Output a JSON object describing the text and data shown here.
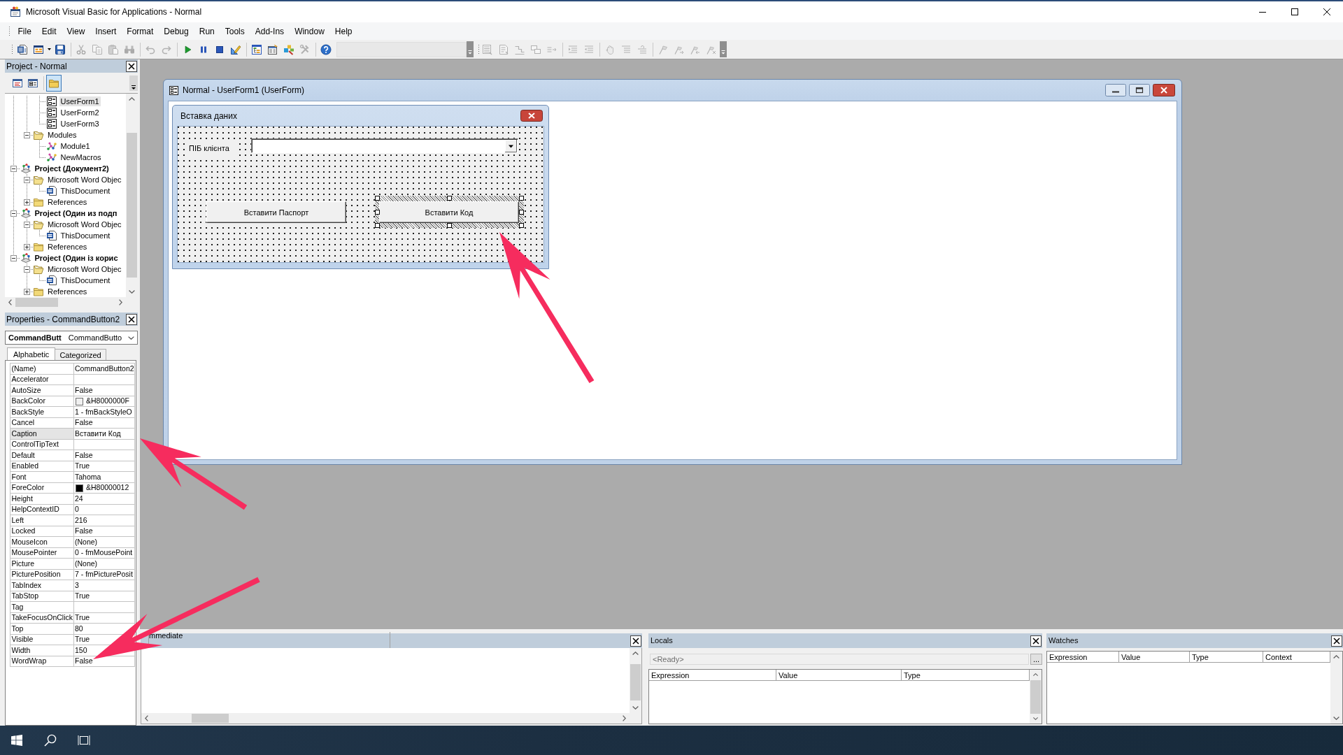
{
  "window": {
    "title": "Microsoft Visual Basic for Applications - Normal"
  },
  "menu": [
    "File",
    "Edit",
    "View",
    "Insert",
    "Format",
    "Debug",
    "Run",
    "Tools",
    "Add-Ins",
    "Window",
    "Help"
  ],
  "standard_toolbar": [
    {
      "kind": "word",
      "disabled": false
    },
    {
      "kind": "insert-form",
      "disabled": false
    },
    {
      "kind": "save",
      "disabled": false
    },
    {
      "kind": "separator"
    },
    {
      "kind": "cut",
      "disabled": true
    },
    {
      "kind": "copy",
      "disabled": true
    },
    {
      "kind": "paste",
      "disabled": true
    },
    {
      "kind": "find",
      "disabled": true
    },
    {
      "kind": "separator"
    },
    {
      "kind": "undo",
      "disabled": true
    },
    {
      "kind": "redo",
      "disabled": true
    },
    {
      "kind": "separator"
    },
    {
      "kind": "run",
      "disabled": false
    },
    {
      "kind": "break",
      "disabled": false
    },
    {
      "kind": "reset",
      "disabled": false
    },
    {
      "kind": "design-mode",
      "disabled": false
    },
    {
      "kind": "separator"
    },
    {
      "kind": "project-explorer",
      "disabled": false
    },
    {
      "kind": "properties-window",
      "disabled": false
    },
    {
      "kind": "object-browser",
      "disabled": false
    },
    {
      "kind": "toolbox",
      "disabled": true
    },
    {
      "kind": "separator"
    },
    {
      "kind": "help",
      "disabled": false
    }
  ],
  "edit_toolbar": [
    {
      "kind": "list-properties",
      "disabled": true
    },
    {
      "kind": "list-constants",
      "disabled": true
    },
    {
      "kind": "quick-info",
      "disabled": true
    },
    {
      "kind": "parameter-info",
      "disabled": true
    },
    {
      "kind": "complete-word",
      "disabled": true
    },
    {
      "kind": "separator"
    },
    {
      "kind": "indent",
      "disabled": true
    },
    {
      "kind": "outdent",
      "disabled": true
    },
    {
      "kind": "separator"
    },
    {
      "kind": "toggle-breakpoint",
      "disabled": true
    },
    {
      "kind": "comment-block",
      "disabled": true
    },
    {
      "kind": "uncomment-block",
      "disabled": true
    },
    {
      "kind": "separator"
    },
    {
      "kind": "toggle-bookmark",
      "disabled": true
    },
    {
      "kind": "next-bookmark",
      "disabled": true
    },
    {
      "kind": "previous-bookmark",
      "disabled": true
    },
    {
      "kind": "clear-bookmarks",
      "disabled": true
    }
  ],
  "project": {
    "title": "Project - Normal",
    "toolbar": [
      {
        "kind": "view-code",
        "pressed": false
      },
      {
        "kind": "view-object",
        "pressed": false
      },
      {
        "kind": "toggle-folders",
        "pressed": true
      }
    ],
    "tree": [
      {
        "children": [
          {
            "children": [
              {
                "label": "UserForm1",
                "kind": "form",
                "selected": true
              },
              {
                "label": "UserForm2",
                "kind": "form",
                "selected": false
              },
              {
                "label": "UserForm3",
                "kind": "form",
                "selected": false
              }
            ]
          },
          {
            "label": "Modules",
            "kind": "folder",
            "expanded": true,
            "selected": false,
            "children": [
              {
                "label": "Module1",
                "kind": "module",
                "selected": false
              },
              {
                "label": "NewMacros",
                "kind": "module",
                "selected": false
              }
            ]
          }
        ]
      },
      {
        "label": "Project (Документ2)",
        "kind": "project",
        "expanded": true,
        "selected": false,
        "children": [
          {
            "label": "Microsoft Word Objec",
            "kind": "folder",
            "expanded": true,
            "selected": false,
            "children": [
              {
                "label": "ThisDocument",
                "kind": "document",
                "selected": false
              }
            ]
          },
          {
            "label": "References",
            "kind": "folder",
            "expanded": false,
            "selected": false
          }
        ]
      },
      {
        "label": "Project (Один из подп",
        "kind": "project",
        "expanded": true,
        "selected": false,
        "children": [
          {
            "label": "Microsoft Word Objec",
            "kind": "folder",
            "expanded": true,
            "selected": false,
            "children": [
              {
                "label": "ThisDocument",
                "kind": "document",
                "selected": false
              }
            ]
          },
          {
            "label": "References",
            "kind": "folder",
            "expanded": false,
            "selected": false
          }
        ]
      },
      {
        "label": "Project (Один із корис",
        "kind": "project",
        "expanded": true,
        "selected": false,
        "children": [
          {
            "label": "Microsoft Word Objec",
            "kind": "folder",
            "expanded": true,
            "selected": false,
            "children": [
              {
                "label": "ThisDocument",
                "kind": "document",
                "selected": false
              }
            ]
          },
          {
            "label": "References",
            "kind": "folder",
            "expanded": false,
            "selected": false
          }
        ]
      }
    ]
  },
  "properties": {
    "title": "Properties - CommandButton2",
    "object_name": "CommandButt",
    "object_type": "CommandButto",
    "tabs": [
      {
        "label": "Alphabetic",
        "selected": true
      },
      {
        "label": "Categorized",
        "selected": false
      }
    ],
    "rows": [
      {
        "name": "(Name)",
        "value": "CommandButton2",
        "selected": false
      },
      {
        "name": "Accelerator",
        "selected": false
      },
      {
        "name": "AutoSize",
        "value": "False",
        "selected": false
      },
      {
        "name": "BackColor",
        "value": "&H8000000F",
        "color": "#f0f0f0",
        "selected": false
      },
      {
        "name": "BackStyle",
        "value": "1 - fmBackStyleO",
        "selected": false
      },
      {
        "name": "Cancel",
        "value": "False",
        "selected": false
      },
      {
        "name": "Caption",
        "value": "Вставити Код",
        "selected": true
      },
      {
        "name": "ControlTipText",
        "selected": false
      },
      {
        "name": "Default",
        "value": "False",
        "selected": false
      },
      {
        "name": "Enabled",
        "value": "True",
        "selected": false
      },
      {
        "name": "Font",
        "value": "Tahoma",
        "selected": false
      },
      {
        "name": "ForeColor",
        "value": "&H80000012",
        "color": "#000000",
        "selected": false
      },
      {
        "name": "Height",
        "value": "24",
        "selected": false
      },
      {
        "name": "HelpContextID",
        "value": "0",
        "selected": false
      },
      {
        "name": "Left",
        "value": "216",
        "selected": false
      },
      {
        "name": "Locked",
        "value": "False",
        "selected": false
      },
      {
        "name": "MouseIcon",
        "value": "(None)",
        "selected": false
      },
      {
        "name": "MousePointer",
        "value": "0 - fmMousePoint",
        "selected": false
      },
      {
        "name": "Picture",
        "value": "(None)",
        "selected": false
      },
      {
        "name": "PicturePosition",
        "value": "7 - fmPicturePosit",
        "selected": false
      },
      {
        "name": "TabIndex",
        "value": "3",
        "selected": false
      },
      {
        "name": "TabStop",
        "value": "True",
        "selected": false
      },
      {
        "name": "Tag",
        "selected": false
      },
      {
        "name": "TakeFocusOnClick",
        "value": "True",
        "selected": false
      },
      {
        "name": "Top",
        "value": "80",
        "selected": false
      },
      {
        "name": "Visible",
        "value": "True",
        "selected": false
      },
      {
        "name": "Width",
        "value": "150",
        "selected": false
      },
      {
        "name": "WordWrap",
        "value": "False",
        "selected": false
      }
    ]
  },
  "designer": {
    "title": "Normal - UserForm1 (UserForm)",
    "form": {
      "title": "Вставка даних",
      "controls": [
        {
          "kind": "label",
          "text": "ПІБ клієнта",
          "selected": false
        },
        {
          "kind": "combobox",
          "selected": false
        },
        {
          "kind": "button",
          "text": "Вставити Паспорт",
          "selected": false
        },
        {
          "kind": "button",
          "text": "Вставити Код",
          "selected": true
        }
      ]
    }
  },
  "immediate": {
    "title": "mmediate"
  },
  "locals": {
    "title": "Locals",
    "context": "<Ready>",
    "button": "...",
    "columns": [
      "Expression",
      "Value",
      "Type"
    ]
  },
  "watches": {
    "title": "Watches",
    "columns": [
      "Expression",
      "Value",
      "Type",
      "Context"
    ]
  }
}
